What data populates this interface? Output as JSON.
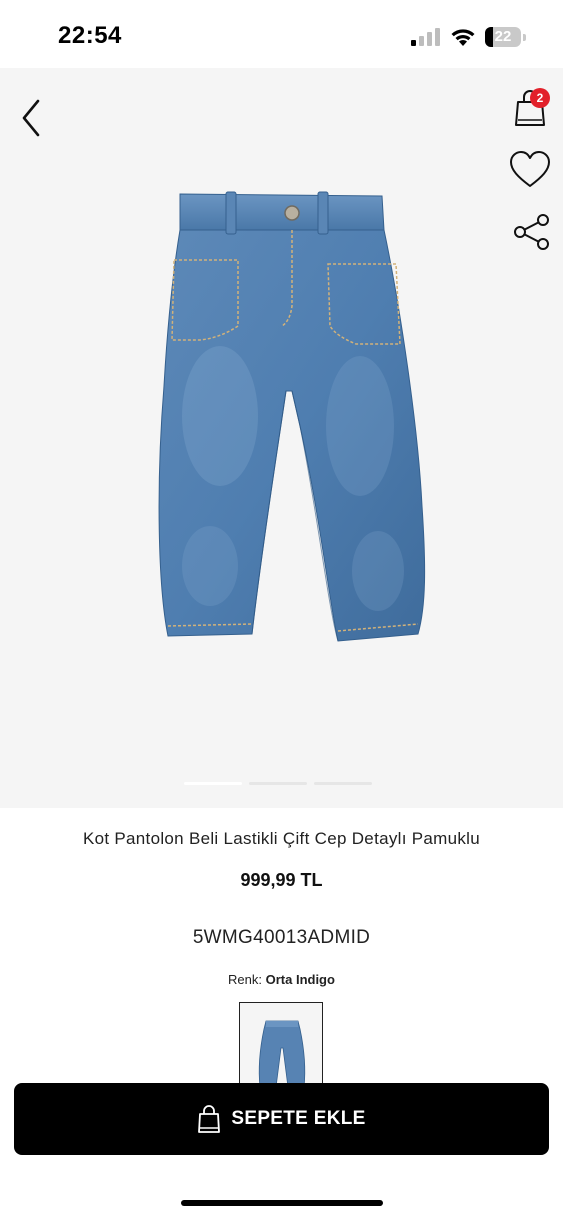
{
  "status_bar": {
    "time": "22:54",
    "battery_level": "22",
    "battery_fraction": 0.22
  },
  "header": {
    "cart_count": "2"
  },
  "gallery": {
    "page_count": 3,
    "active_page": 1,
    "image_description_icon": "jeans-product-image"
  },
  "product": {
    "title": "Kot Pantolon Beli Lastikli Çift Cep Detaylı Pamuklu",
    "price": "999,99 TL",
    "sku": "5WMG40013ADMID",
    "color_label": "Renk:",
    "color_value": "Orta Indigo"
  },
  "actions": {
    "add_to_cart_label": "SEPETE EKLE"
  },
  "colors": {
    "badge": "#e2202a",
    "button_bg": "#000000",
    "gallery_bg": "#f5f5f5"
  }
}
